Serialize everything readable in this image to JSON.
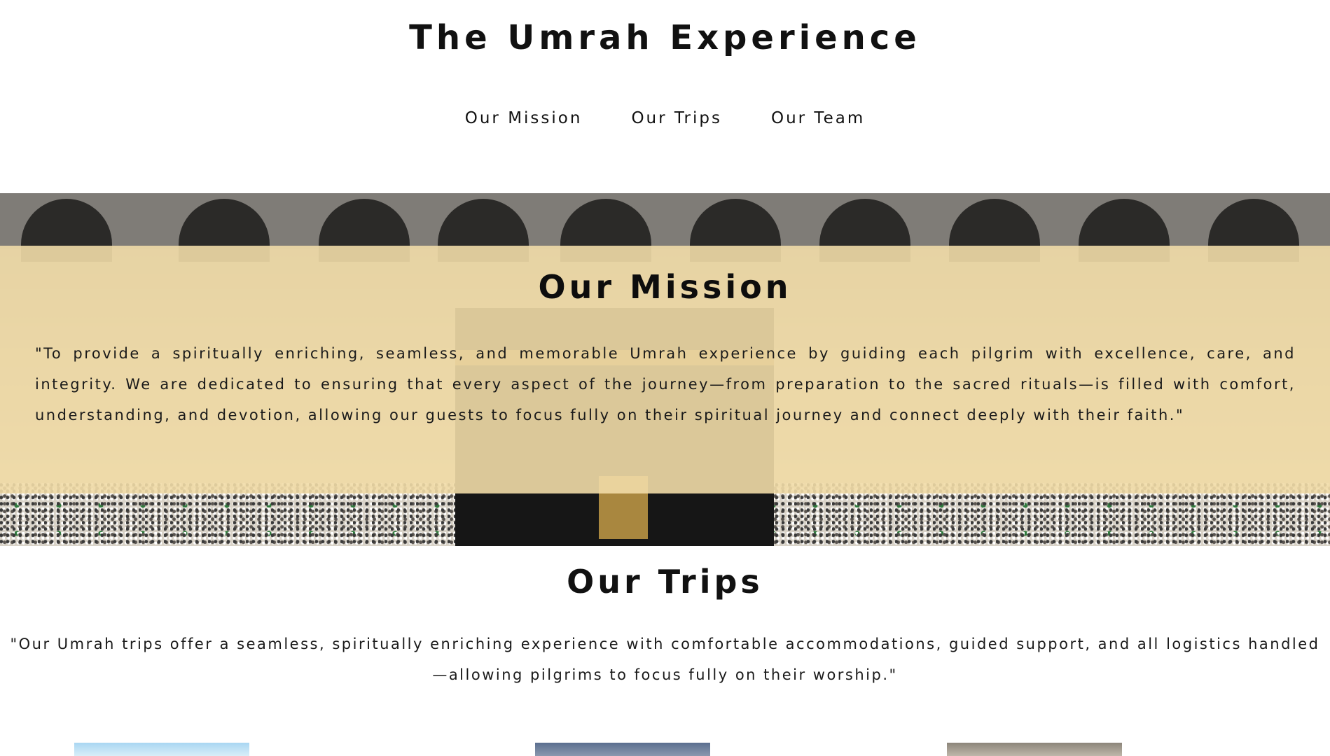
{
  "header": {
    "title": "The Umrah Experience"
  },
  "nav": {
    "items": [
      {
        "label": "Our Mission"
      },
      {
        "label": "Our Trips"
      },
      {
        "label": "Our Team"
      }
    ]
  },
  "mission": {
    "title": "Our Mission",
    "text": "\"To provide a spiritually enriching, seamless, and memorable Umrah experience by guiding each pilgrim with excellence, care, and integrity. We are dedicated to ensuring that every aspect of the journey—from preparation to the sacred rituals—is filled with comfort, understanding, and devotion, allowing our guests to focus fully on their spiritual journey and connect deeply with their faith.\""
  },
  "trips": {
    "title": "Our Trips",
    "text": "\"Our Umrah trips offer a seamless, spiritually enriching experience with comfortable accommodations, guided support, and all logistics handled—allowing pilgrims to focus fully on their worship.\""
  },
  "colors": {
    "overlay": "#f1dba7",
    "text": "#111111",
    "background": "#ffffff"
  }
}
